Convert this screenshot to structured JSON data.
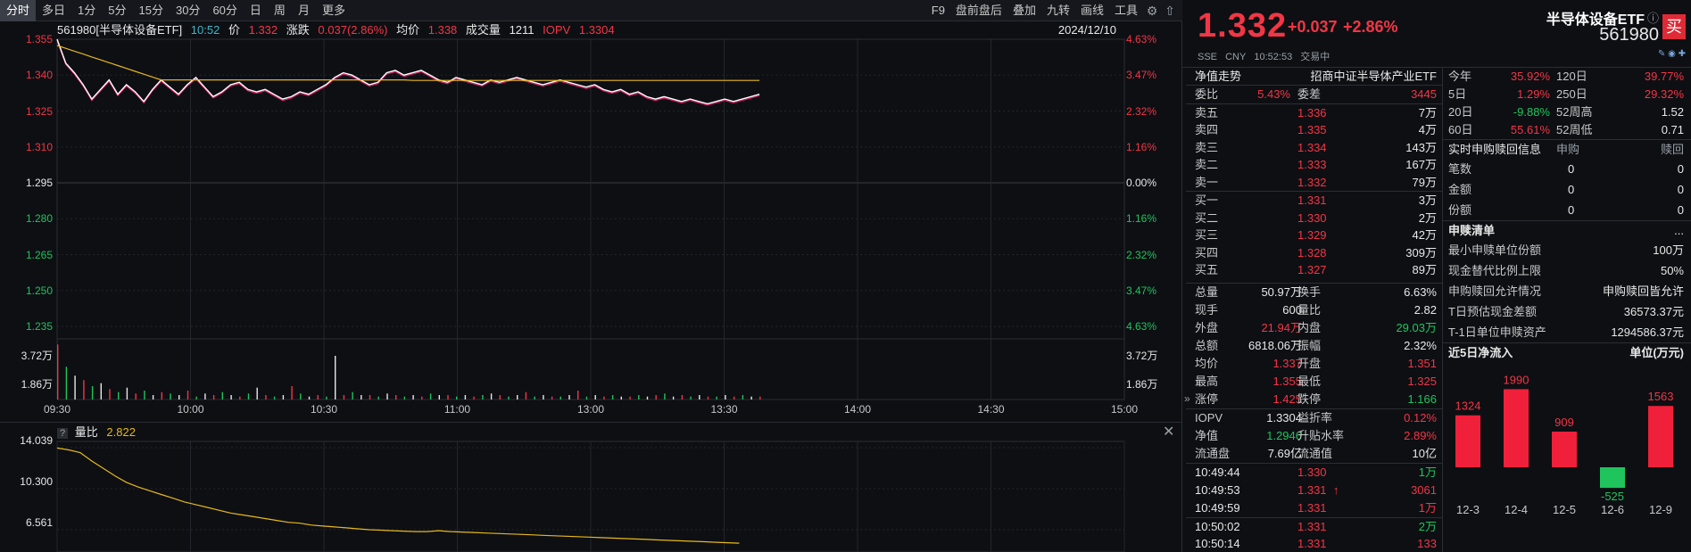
{
  "toolbar": {
    "tabs": [
      "分时",
      "多日",
      "1分",
      "5分",
      "15分",
      "30分",
      "60分",
      "日",
      "周",
      "月",
      "更多"
    ],
    "right": [
      "F9",
      "盘前盘后",
      "叠加",
      "九转",
      "画线",
      "工具"
    ]
  },
  "info": {
    "name": "561980[半导体设备ETF]",
    "time": "10:52",
    "price_label": "价",
    "price": "1.332",
    "chg_label": "涨跌",
    "chg": "0.037(2.86%)",
    "avg_label": "均价",
    "avg": "1.338",
    "vol_label": "成交量",
    "vol": "1211",
    "iopv_label": "IOPV",
    "iopv": "1.3304",
    "date": "2024/12/10"
  },
  "y_left": [
    "1.355",
    "1.340",
    "1.325",
    "1.310",
    "1.295",
    "1.280",
    "1.265",
    "1.250",
    "1.235"
  ],
  "y_right": [
    "4.63%",
    "3.47%",
    "2.32%",
    "1.16%",
    "0.00%",
    "1.16%",
    "2.32%",
    "3.47%",
    "4.63%"
  ],
  "vol_left": [
    "3.72万",
    "1.86万"
  ],
  "vol_right": [
    "3.72万",
    "1.86万"
  ],
  "x_labels": [
    "09:30",
    "10:00",
    "10:30",
    "11:00",
    "13:00",
    "13:30",
    "14:00",
    "14:30",
    "15:00"
  ],
  "sub": {
    "q": "?",
    "label": "量比",
    "value": "2.822",
    "y": [
      "14.039",
      "10.300",
      "6.561"
    ]
  },
  "quote": {
    "price": "1.332",
    "chg": "+0.037",
    "chgp": "+2.86%",
    "exch": "SSE",
    "cur": "CNY",
    "time": "10:52:53",
    "status": "交易中",
    "name": "半导体设备ETF",
    "code": "561980",
    "buy": "买"
  },
  "book": {
    "head_left": "净值走势",
    "head_right": "招商中证半导体产业ETF",
    "ratio_label": "委比",
    "ratio": "5.43%",
    "diff_label": "委差",
    "diff": "3445",
    "asks": [
      [
        "卖五",
        "1.336",
        "7万"
      ],
      [
        "卖四",
        "1.335",
        "4万"
      ],
      [
        "卖三",
        "1.334",
        "143万"
      ],
      [
        "卖二",
        "1.333",
        "167万"
      ],
      [
        "卖一",
        "1.332",
        "79万"
      ]
    ],
    "bids": [
      [
        "买一",
        "1.331",
        "3万"
      ],
      [
        "买二",
        "1.330",
        "2万"
      ],
      [
        "买三",
        "1.329",
        "42万"
      ],
      [
        "买四",
        "1.328",
        "309万"
      ],
      [
        "买五",
        "1.327",
        "89万"
      ]
    ]
  },
  "stats": [
    [
      "总量",
      "50.97万",
      "换手",
      "6.63%"
    ],
    [
      "现手",
      "600",
      "量比",
      "2.82"
    ],
    [
      "外盘",
      "21.94万",
      "内盘",
      "29.03万"
    ],
    [
      "总额",
      "6818.06万",
      "振幅",
      "2.32%"
    ],
    [
      "均价",
      "1.337",
      "开盘",
      "1.351"
    ],
    [
      "最高",
      "1.355",
      "最低",
      "1.325"
    ],
    [
      "涨停",
      "1.425",
      "跌停",
      "1.166"
    ]
  ],
  "etf": [
    [
      "IOPV",
      "1.3304",
      "溢折率",
      "0.12%"
    ],
    [
      "净值",
      "1.2946",
      "升贴水率",
      "2.89%"
    ],
    [
      "流通盘",
      "7.69亿",
      "流通值",
      "10亿"
    ]
  ],
  "ticks": [
    [
      "10:49:44",
      "1.330",
      "1万"
    ],
    [
      "10:49:53",
      "1.331",
      "3061"
    ],
    [
      "10:49:59",
      "1.331",
      "1万"
    ],
    [
      "10:50:02",
      "1.331",
      "2万"
    ],
    [
      "10:50:14",
      "1.331",
      "133"
    ]
  ],
  "perf": [
    [
      "今年",
      "35.92%",
      "120日",
      "39.77%"
    ],
    [
      "5日",
      "1.29%",
      "250日",
      "29.32%"
    ],
    [
      "20日",
      "-9.88%",
      "52周高",
      "1.52"
    ],
    [
      "60日",
      "55.61%",
      "52周低",
      "0.71"
    ]
  ],
  "creation": {
    "title": "实时申购赎回信息",
    "c1": "申购",
    "c2": "赎回",
    "rows": [
      [
        "笔数",
        "0",
        "0"
      ],
      [
        "金额",
        "0",
        "0"
      ],
      [
        "份额",
        "0",
        "0"
      ]
    ]
  },
  "list": {
    "title": "申赎清单",
    "more": "...",
    "rows": [
      [
        "最小申赎单位份额",
        "100万"
      ],
      [
        "现金替代比例上限",
        "50%"
      ],
      [
        "申购赎回允许情况",
        "申购赎回皆允许"
      ],
      [
        "T日预估现金差额",
        "36573.37元"
      ],
      [
        "T-1日单位申赎资产",
        "1294586.37元"
      ]
    ]
  },
  "flow": {
    "title": "近5日净流入",
    "unit": "单位(万元)"
  },
  "chart_data": {
    "type": "bar",
    "title": "近5日净流入",
    "ylabel": "单位(万元)",
    "categories": [
      "12-3",
      "12-4",
      "12-5",
      "12-6",
      "12-9"
    ],
    "values": [
      1324,
      1990,
      909,
      -525,
      1563
    ]
  }
}
